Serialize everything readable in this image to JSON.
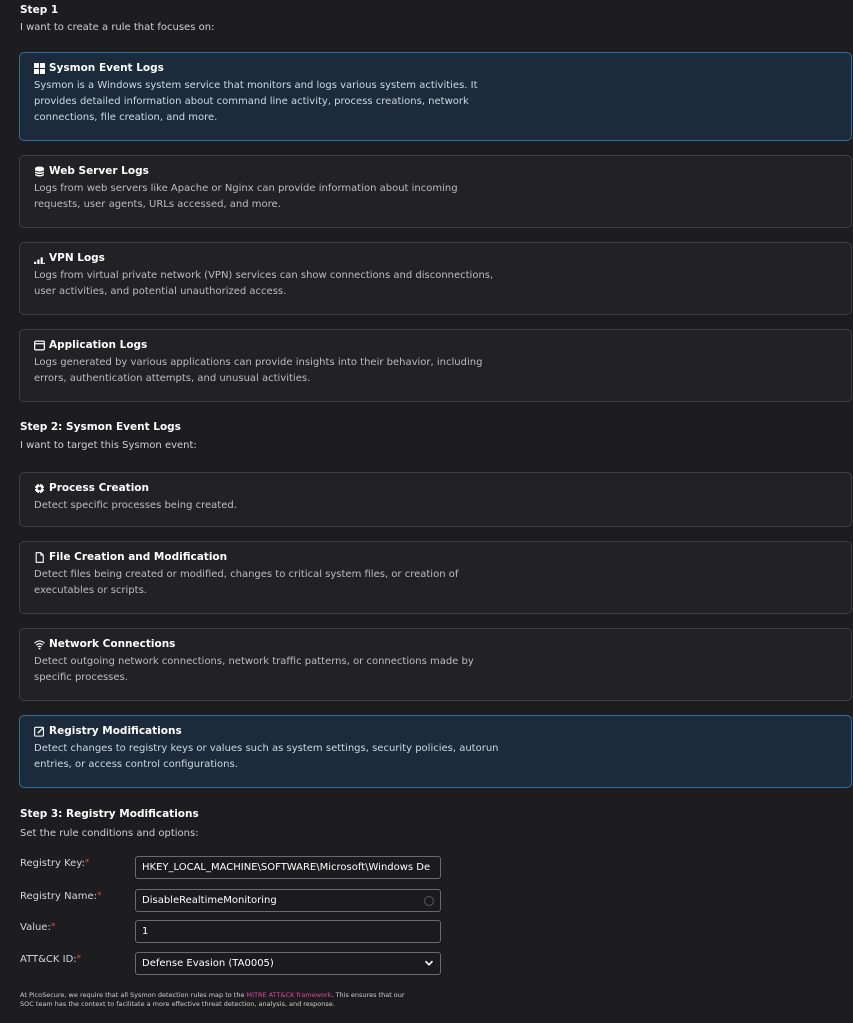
{
  "step1": {
    "heading": "Step 1",
    "subheading": "I want to create a rule that focuses on:",
    "options": [
      {
        "title": "Sysmon Event Logs",
        "icon": "windows-icon",
        "desc": "Sysmon is a Windows system service that monitors and logs various system activities. It provides detailed information about command line activity, process creations, network connections, file creation, and more.",
        "selected": true
      },
      {
        "title": "Web Server Logs",
        "icon": "database-icon",
        "desc": "Logs from web servers like Apache or Nginx can provide information about incoming requests, user agents, URLs accessed, and more.",
        "selected": false
      },
      {
        "title": "VPN Logs",
        "icon": "signal-icon",
        "desc": "Logs from virtual private network (VPN) services can show connections and disconnections, user activities, and potential unauthorized access.",
        "selected": false
      },
      {
        "title": "Application Logs",
        "icon": "window-icon",
        "desc": "Logs generated by various applications can provide insights into their behavior, including errors, authentication attempts, and unusual activities.",
        "selected": false
      }
    ]
  },
  "step2": {
    "heading": "Step 2: Sysmon Event Logs",
    "subheading": "I want to target this Sysmon event:",
    "options": [
      {
        "title": "Process Creation",
        "icon": "gear-icon",
        "desc": "Detect specific processes being created.",
        "selected": false
      },
      {
        "title": "File Creation and Modification",
        "icon": "file-icon",
        "desc": "Detect files being created or modified, changes to critical system files, or creation of executables or scripts.",
        "selected": false
      },
      {
        "title": "Network Connections",
        "icon": "wifi-icon",
        "desc": "Detect outgoing network connections, network traffic patterns, or connections made by specific processes.",
        "selected": false
      },
      {
        "title": "Registry Modifications",
        "icon": "edit-icon",
        "desc": "Detect changes to registry keys or values such as system settings, security policies, autorun entries, or access control configurations.",
        "selected": true
      }
    ]
  },
  "step3": {
    "heading": "Step 3: Registry Modifications",
    "subheading": "Set the rule conditions and options:",
    "fields": {
      "registry_key": {
        "label": "Registry Key:",
        "value": "HKEY_LOCAL_MACHINE\\SOFTWARE\\Microsoft\\Windows De"
      },
      "registry_name": {
        "label": "Registry Name:",
        "value": "DisableRealtimeMonitoring"
      },
      "value": {
        "label": "Value:",
        "value": "1"
      },
      "attack_id": {
        "label": "ATT&CK ID:",
        "value": "Defense Evasion (TA0005)"
      }
    },
    "required_mark": "*"
  },
  "footer": {
    "text_before": "At PicoSecure, we require that all Sysmon detection rules map to the ",
    "link": "MITRE ATT&CK framework",
    "text_after": ". This ensures that our SOC team has the context to facilitate a more effective threat detection, analysis, and response."
  },
  "colors": {
    "accent": "#2f6f9f",
    "required": "#e0454d",
    "link": "#e0459a"
  }
}
